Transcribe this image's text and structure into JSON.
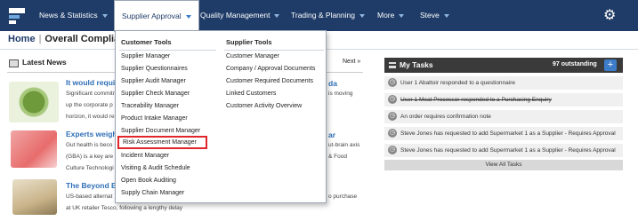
{
  "navbar": {
    "items": [
      {
        "label": "News & Statistics"
      },
      {
        "label": "Supplier Approval"
      },
      {
        "label": "Quality Management"
      },
      {
        "label": "Trading & Planning"
      },
      {
        "label": "More"
      },
      {
        "label": "Steve"
      }
    ],
    "gear_icon": "gear-icon"
  },
  "breadcrumb": {
    "home": "Home",
    "separator": "|",
    "current": "Overall Complian"
  },
  "dropdown": {
    "customer_tools": {
      "heading": "Customer Tools",
      "items": [
        "Supplier Manager",
        "Supplier Questionnaires",
        "Supplier Audit Manager",
        "Supplier Check Manager",
        "Traceability Manager",
        "Product Intake Manager",
        "Supplier Document Manager",
        "Risk Assessment Manager",
        "Incident Manager",
        "Visiting & Audit Schedule",
        "Open Book Auditing",
        "Supply Chain Manager"
      ]
    },
    "supplier_tools": {
      "heading": "Supplier Tools",
      "items": [
        "Customer Manager",
        "Company / Approval Documents",
        "Customer Required Documents",
        "Linked Customers",
        "Customer Activity Overview"
      ]
    },
    "highlight_color": "#e0262b"
  },
  "news": {
    "heading": "Latest News",
    "next_label": "Next »",
    "articles": [
      {
        "title": "It would requir",
        "lines": [
          "Significant commitr",
          "up the corporate p",
          "horizon, it would re"
        ],
        "right": [
          "da",
          "is moving"
        ]
      },
      {
        "title": "Experts weigh",
        "lines": [
          "Gut health is beco",
          "(GBA) is a key are",
          "Culture Technologi"
        ],
        "right": [
          "ar",
          "ut-brain axis",
          "& Food"
        ]
      },
      {
        "title": "The Beyond B",
        "lines": [
          "US-based alternat",
          "at UK retailer Tesco, following a lengthy delay"
        ],
        "right": [
          "o purchase"
        ]
      }
    ]
  },
  "tasks": {
    "heading": "My Tasks",
    "count": "97 outstanding",
    "add_label": "+",
    "items": [
      {
        "text": "User 1 Abattoir responded to a questionnaire",
        "done": false
      },
      {
        "text": "User 1 Meat Processor responded to a Purchasing Enquiry",
        "done": true
      },
      {
        "text": "An order requires confirmation note",
        "done": false
      },
      {
        "text": "Steve Jones has requested to add Supermarket 1 as a Supplier - Requires Approval",
        "done": false
      },
      {
        "text": "Steve Jones has requested to add Supermarket 1 as a Supplier - Requires Approval",
        "done": false
      }
    ],
    "view_all": "View All Tasks"
  },
  "colors": {
    "navbar": "#1f3c68",
    "link": "#2f6fb7",
    "accent": "#3d7cc9"
  }
}
